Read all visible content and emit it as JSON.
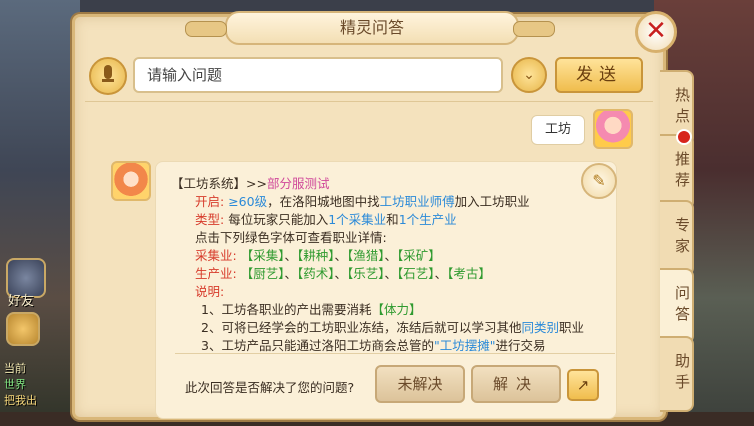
{
  "window": {
    "title": "精灵问答"
  },
  "input": {
    "placeholder": "请输入问题",
    "send_label": "发送"
  },
  "conversation": {
    "user_message": "工坊",
    "answer": {
      "line1": {
        "prefix": "【工坊系统】>>",
        "tag": "部分服测试"
      },
      "line2": {
        "label": "开启:",
        "level": "≥60级",
        "text1": "，在洛阳城地图中找",
        "npc": "工坊职业师傅",
        "text2": "加入工坊职业"
      },
      "line3": {
        "label": "类型:",
        "text1": "每位玩家只能加入",
        "a": "1个采集业",
        "text2": "和",
        "b": "1个生产业"
      },
      "line4": "点击下列绿色字体可查看职业详情:",
      "line5": {
        "label": "采集业:",
        "items": [
          "【采集】",
          "【耕种】",
          "【渔猎】",
          "【采矿】"
        ]
      },
      "line6": {
        "label": "生产业:",
        "items": [
          "【厨艺】",
          "【药术】",
          "【乐艺】",
          "【石艺】",
          "【考古】"
        ]
      },
      "line7": "说明:",
      "line8": {
        "text1": "1、工坊各职业的产出需要消耗",
        "link": "【体力】"
      },
      "line9": {
        "text1": "2、可将已经学会的工坊职业冻结，冻结后就可以学习其他",
        "link": "同类别",
        "text2": "职业"
      },
      "line10": {
        "text1": "3、工坊产品只能通过洛阳工坊商会总管的",
        "link": "\"工坊摆摊\"",
        "text2": "进行交易"
      }
    },
    "feedback": {
      "question": "此次回答是否解决了您的问题?",
      "unresolved": "未解决",
      "resolved": "解决"
    }
  },
  "side_tabs": [
    {
      "label": "热点"
    },
    {
      "label": "推荐"
    },
    {
      "label": "专家"
    },
    {
      "label": "问答",
      "active": true
    },
    {
      "label": "助手"
    }
  ],
  "hud": {
    "friends_label": "好友",
    "chat_lines": [
      "当前",
      "世界",
      "把我出"
    ]
  },
  "colors": {
    "accent_red": "#d73c2c",
    "link_blue": "#2b8ad8",
    "link_green": "#2f9a2f",
    "panel": "#f4e2bd"
  }
}
